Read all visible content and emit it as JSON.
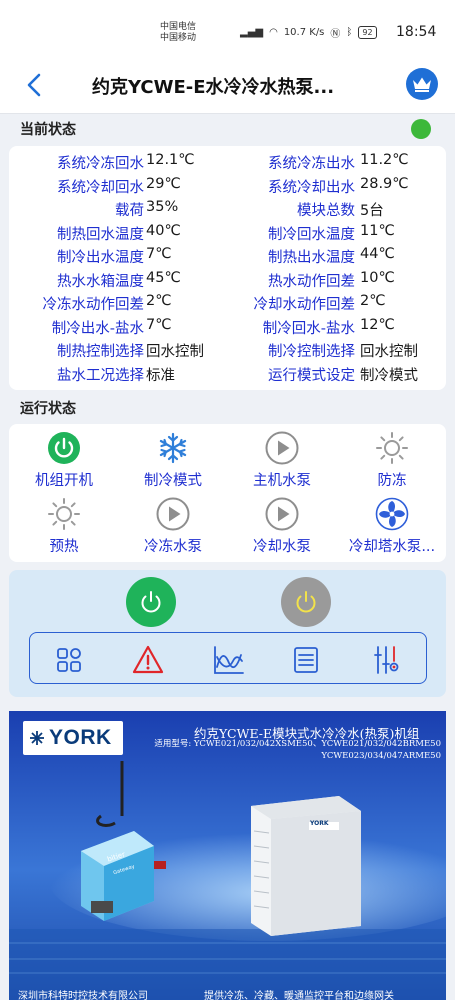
{
  "status_bar": {
    "carrier_1": "中国电信",
    "carrier_2": "中国移动",
    "network_speed": "10.7 K/s",
    "battery": "92",
    "time": "18:54"
  },
  "nav": {
    "title": "约克YCWE-E水冷冷水热泵..."
  },
  "current_status": {
    "section_title": "当前状态",
    "indicator_color": "#3db83a",
    "rows": [
      {
        "label": "系统冷冻回水",
        "value": "12.1℃",
        "label2": "系统冷冻出水",
        "value2": "11.2℃"
      },
      {
        "label": "系统冷却回水",
        "value": "29℃",
        "label2": "系统冷却出水",
        "value2": "28.9℃"
      },
      {
        "label": "载荷",
        "value": "35%",
        "label2": "模块总数",
        "value2": "5台"
      },
      {
        "label": "制热回水温度",
        "value": "40℃",
        "label2": "制冷回水温度",
        "value2": "11℃"
      },
      {
        "label": "制冷出水温度",
        "value": "7℃",
        "label2": "制热出水温度",
        "value2": "44℃"
      },
      {
        "label": "热水水箱温度",
        "value": "45℃",
        "label2": "热水动作回差",
        "value2": "10℃"
      },
      {
        "label": "冷冻水动作回差",
        "value": "2℃",
        "label2": "冷却水动作回差",
        "value2": "2℃"
      },
      {
        "label": "制冷出水-盐水",
        "value": "7℃",
        "label2": "制冷回水-盐水",
        "value2": "12℃"
      },
      {
        "label": "制热控制选择",
        "value": "回水控制",
        "label2": "制冷控制选择",
        "value2": "回水控制"
      },
      {
        "label": "盐水工况选择",
        "value": "标准",
        "label2": "运行模式设定",
        "value2": "制冷模式"
      }
    ]
  },
  "run_status": {
    "section_title": "运行状态",
    "items": [
      {
        "label": "机组开机",
        "icon": "power-icon"
      },
      {
        "label": "制冷模式",
        "icon": "snowflake-icon"
      },
      {
        "label": "主机水泵",
        "icon": "play-icon"
      },
      {
        "label": "防冻",
        "icon": "sun-icon"
      },
      {
        "label": "预热",
        "icon": "sun-icon"
      },
      {
        "label": "冷冻水泵",
        "icon": "play-icon"
      },
      {
        "label": "冷却水泵",
        "icon": "play-icon"
      },
      {
        "label": "冷却塔水泵...",
        "icon": "fan-icon"
      }
    ]
  },
  "controls": {
    "power_on_color": "#1fb35a",
    "power_off_color": "#9a9a9a",
    "tools": [
      "grid-icon",
      "warning-icon",
      "chart-icon",
      "list-icon",
      "settings-sliders-icon"
    ],
    "accent": "#2b5fd1",
    "warning_color": "#e0262a"
  },
  "banner": {
    "brand": "YORK",
    "title": "约克YCWE-E模块式水冷冷水(热泵)机组",
    "models_line1": "适用型号: YCWE021/032/042XSME50、YCWE021/032/042BRME50",
    "models_line2": "YCWE023/034/047ARME50",
    "device_brand": "bitier",
    "device_label": "Gateway",
    "unit_badge": "YORK",
    "company": "深圳市科特时控技术有限公司",
    "slogan": "提供冷冻、冷藏、暖通监控平台和边缘网关"
  }
}
